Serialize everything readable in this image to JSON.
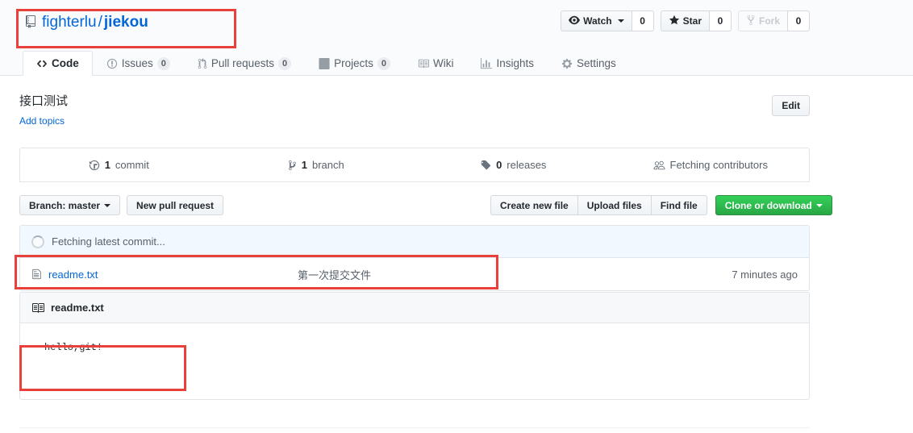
{
  "repo": {
    "icon": "repo-icon",
    "owner": "fighterlu",
    "separator": "/",
    "name": "jiekou",
    "description": "接口测试",
    "add_topics_label": "Add topics",
    "edit_label": "Edit"
  },
  "actions": [
    {
      "label": "Watch",
      "count": "0",
      "icon": "eye-icon",
      "has_caret": true,
      "disabled": false
    },
    {
      "label": "Star",
      "count": "0",
      "icon": "star-icon",
      "has_caret": false,
      "disabled": false
    },
    {
      "label": "Fork",
      "count": "0",
      "icon": "fork-icon",
      "has_caret": false,
      "disabled": true
    }
  ],
  "tabs": [
    {
      "label": "Code",
      "icon": "code-icon",
      "count": null,
      "selected": true
    },
    {
      "label": "Issues",
      "icon": "issue-opened-icon",
      "count": "0",
      "selected": false
    },
    {
      "label": "Pull requests",
      "icon": "git-pull-request-icon",
      "count": "0",
      "selected": false
    },
    {
      "label": "Projects",
      "icon": "project-board-icon",
      "count": "0",
      "selected": false
    },
    {
      "label": "Wiki",
      "icon": "book-icon",
      "count": null,
      "selected": false
    },
    {
      "label": "Insights",
      "icon": "graph-icon",
      "count": null,
      "selected": false
    },
    {
      "label": "Settings",
      "icon": "gear-icon",
      "count": null,
      "selected": false
    }
  ],
  "summary": [
    {
      "num": "1",
      "label": "commit",
      "icon": "history-icon"
    },
    {
      "num": "1",
      "label": "branch",
      "icon": "git-branch-icon"
    },
    {
      "num": "0",
      "label": "releases",
      "icon": "tag-icon"
    },
    {
      "num": "",
      "label": "Fetching contributors",
      "icon": "people-icon"
    }
  ],
  "toolbar": {
    "branch_label": "Branch: master",
    "new_pull_request_label": "New pull request",
    "create_new_file_label": "Create new file",
    "upload_files_label": "Upload files",
    "find_file_label": "Find file",
    "clone_or_download_label": "Clone or download"
  },
  "files": {
    "fetching_label": "Fetching latest commit...",
    "rows": [
      {
        "name": "readme.txt",
        "icon": "file-text-icon",
        "message": "第一次提交文件",
        "age": "7 minutes ago"
      }
    ]
  },
  "readme": {
    "icon": "book-icon",
    "title": "readme.txt",
    "content": "hello,git!"
  },
  "colors": {
    "link": "#0366d6",
    "green_button": "#28a745",
    "annotation": "#e8413c",
    "muted_text": "#586069"
  },
  "annotations": [
    {
      "name": "repo-title-highlight"
    },
    {
      "name": "file-row-highlight"
    },
    {
      "name": "readme-content-highlight"
    }
  ]
}
